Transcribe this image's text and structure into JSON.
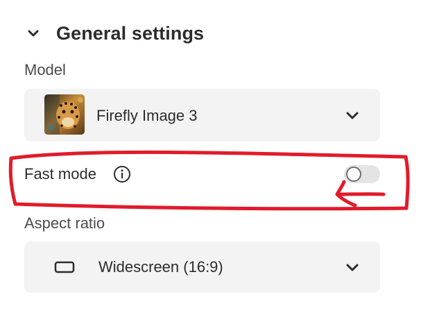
{
  "section": {
    "title": "General settings",
    "expanded": true,
    "icon": "chevron-down-icon"
  },
  "model": {
    "label": "Model",
    "selected": "Firefly Image 3",
    "thumbnail": "leopard-thumbnail"
  },
  "fast_mode": {
    "label": "Fast mode",
    "info_icon": "info-icon",
    "enabled": false
  },
  "aspect_ratio": {
    "label": "Aspect ratio",
    "selected": "Widescreen (16:9)",
    "icon": "widescreen-rectangle-icon"
  },
  "annotation": {
    "color": "#e11b2a",
    "shapes": [
      "highlight-outline",
      "arrow-pointing-left"
    ]
  }
}
